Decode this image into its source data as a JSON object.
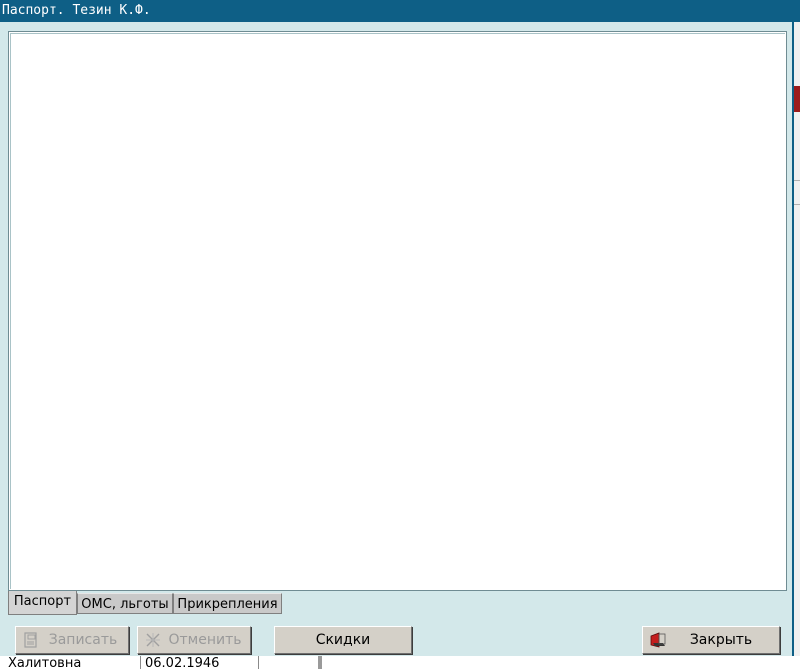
{
  "window": {
    "title": "Паспорт. Тезин К.Ф."
  },
  "tabs": [
    {
      "label": "Паспорт",
      "active": true
    },
    {
      "label": "ОМС, льготы",
      "active": false
    },
    {
      "label": "Прикрепления",
      "active": false
    }
  ],
  "buttons": {
    "save": "Записать",
    "cancel": "Отменить",
    "discounts": "Скидки",
    "close": "Закрыть"
  },
  "background": {
    "patronymic": "Халитовна",
    "date": "06.02.1946"
  },
  "colors": {
    "titlebar": "#0e5f86",
    "window_bg": "#d3e8ea",
    "accent_red": "#9b1b1b"
  }
}
